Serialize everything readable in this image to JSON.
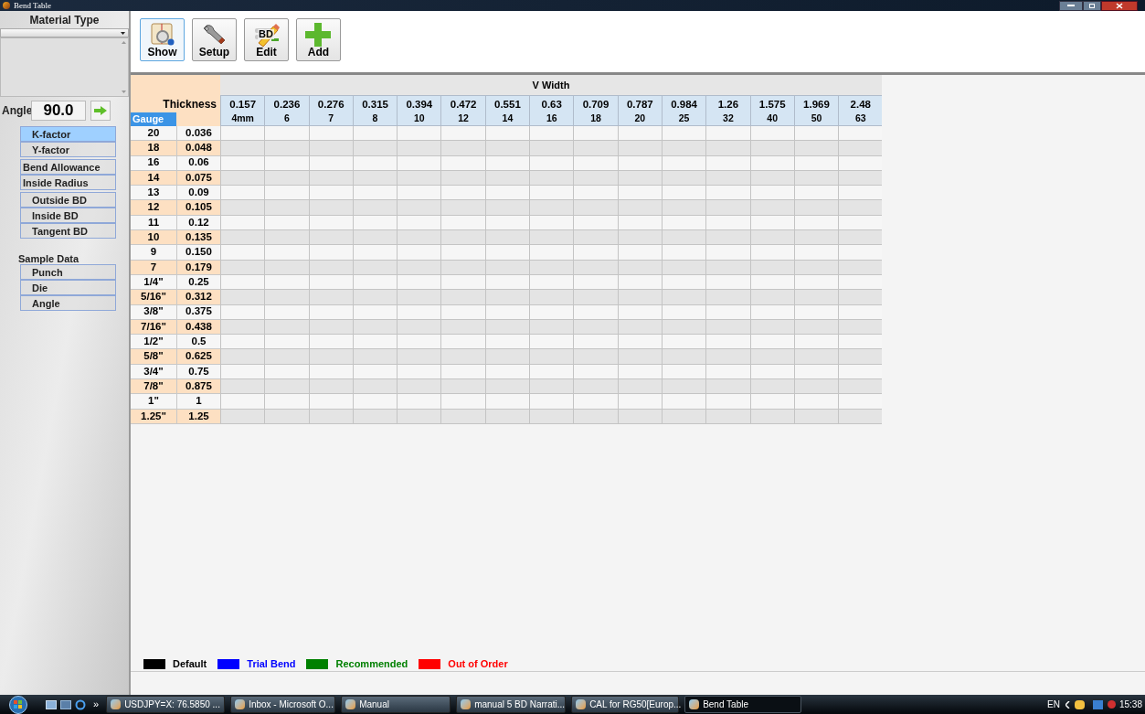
{
  "window": {
    "title": "Bend Table"
  },
  "sidebar": {
    "material_type_label": "Material Type",
    "angle_label": "Angle",
    "angle_value": "90.0",
    "groups": [
      {
        "items": [
          {
            "label": "K-factor",
            "selected": true
          },
          {
            "label": "Y-factor",
            "selected": false
          }
        ]
      },
      {
        "items": [
          {
            "label": "Bend Allowance",
            "selected": false
          },
          {
            "label": "Inside Radius",
            "selected": false
          }
        ]
      },
      {
        "items": [
          {
            "label": "Outside BD",
            "selected": false
          },
          {
            "label": "Inside BD",
            "selected": false
          },
          {
            "label": "Tangent BD",
            "selected": false
          }
        ]
      },
      {
        "heading": "Sample Data",
        "items": [
          {
            "label": "Punch",
            "selected": false
          },
          {
            "label": "Die",
            "selected": false
          },
          {
            "label": "Angle",
            "selected": false
          }
        ]
      }
    ]
  },
  "toolbar": [
    {
      "kind": "show",
      "label": "Show",
      "selected": true
    },
    {
      "kind": "setup",
      "label": "Setup",
      "selected": false
    },
    {
      "kind": "edit",
      "label": "Edit",
      "badge": "BD",
      "selected": false
    },
    {
      "kind": "add",
      "label": "Add",
      "selected": false
    }
  ],
  "table": {
    "group_header": "V Width",
    "thickness_header": "Thickness",
    "gauge_header": "Gauge",
    "columns": [
      {
        "inch": "0.157",
        "mm": "4mm"
      },
      {
        "inch": "0.236",
        "mm": "6"
      },
      {
        "inch": "0.276",
        "mm": "7"
      },
      {
        "inch": "0.315",
        "mm": "8"
      },
      {
        "inch": "0.394",
        "mm": "10"
      },
      {
        "inch": "0.472",
        "mm": "12"
      },
      {
        "inch": "0.551",
        "mm": "14"
      },
      {
        "inch": "0.63",
        "mm": "16"
      },
      {
        "inch": "0.709",
        "mm": "18"
      },
      {
        "inch": "0.787",
        "mm": "20"
      },
      {
        "inch": "0.984",
        "mm": "25"
      },
      {
        "inch": "1.26",
        "mm": "32"
      },
      {
        "inch": "1.575",
        "mm": "40"
      },
      {
        "inch": "1.969",
        "mm": "50"
      },
      {
        "inch": "2.48",
        "mm": "63"
      }
    ],
    "rows": [
      {
        "gauge": "20",
        "thickness": "0.036"
      },
      {
        "gauge": "18",
        "thickness": "0.048"
      },
      {
        "gauge": "16",
        "thickness": "0.06"
      },
      {
        "gauge": "14",
        "thickness": "0.075"
      },
      {
        "gauge": "13",
        "thickness": "0.09"
      },
      {
        "gauge": "12",
        "thickness": "0.105"
      },
      {
        "gauge": "11",
        "thickness": "0.12"
      },
      {
        "gauge": "10",
        "thickness": "0.135"
      },
      {
        "gauge": "9",
        "thickness": "0.150"
      },
      {
        "gauge": "7",
        "thickness": "0.179"
      },
      {
        "gauge": "1/4\"",
        "thickness": "0.25"
      },
      {
        "gauge": "5/16\"",
        "thickness": "0.312"
      },
      {
        "gauge": "3/8\"",
        "thickness": "0.375"
      },
      {
        "gauge": "7/16\"",
        "thickness": "0.438"
      },
      {
        "gauge": "1/2\"",
        "thickness": "0.5"
      },
      {
        "gauge": "5/8\"",
        "thickness": "0.625"
      },
      {
        "gauge": "3/4\"",
        "thickness": "0.75"
      },
      {
        "gauge": "7/8\"",
        "thickness": "0.875"
      },
      {
        "gauge": "1\"",
        "thickness": "1"
      },
      {
        "gauge": "1.25\"",
        "thickness": "1.25"
      }
    ]
  },
  "legend": [
    {
      "label": "Default",
      "color": "#000000"
    },
    {
      "label": "Trial Bend",
      "color": "#0000ff"
    },
    {
      "label": "Recommended",
      "color": "#008000"
    },
    {
      "label": "Out of Order",
      "color": "#ff0000"
    }
  ],
  "taskbar": {
    "tasks": [
      {
        "label": "USDJPY=X: 76.5850 ...",
        "selected": false
      },
      {
        "label": "Inbox - Microsoft O...",
        "selected": false
      },
      {
        "label": "Manual",
        "selected": false
      },
      {
        "label": "manual 5 BD Narrati...",
        "selected": false
      },
      {
        "label": "CAL for RG50[Europ...",
        "selected": false
      },
      {
        "label": "Bend Table",
        "selected": true
      }
    ],
    "overflow": "»",
    "language": "EN",
    "time": "15:38"
  }
}
